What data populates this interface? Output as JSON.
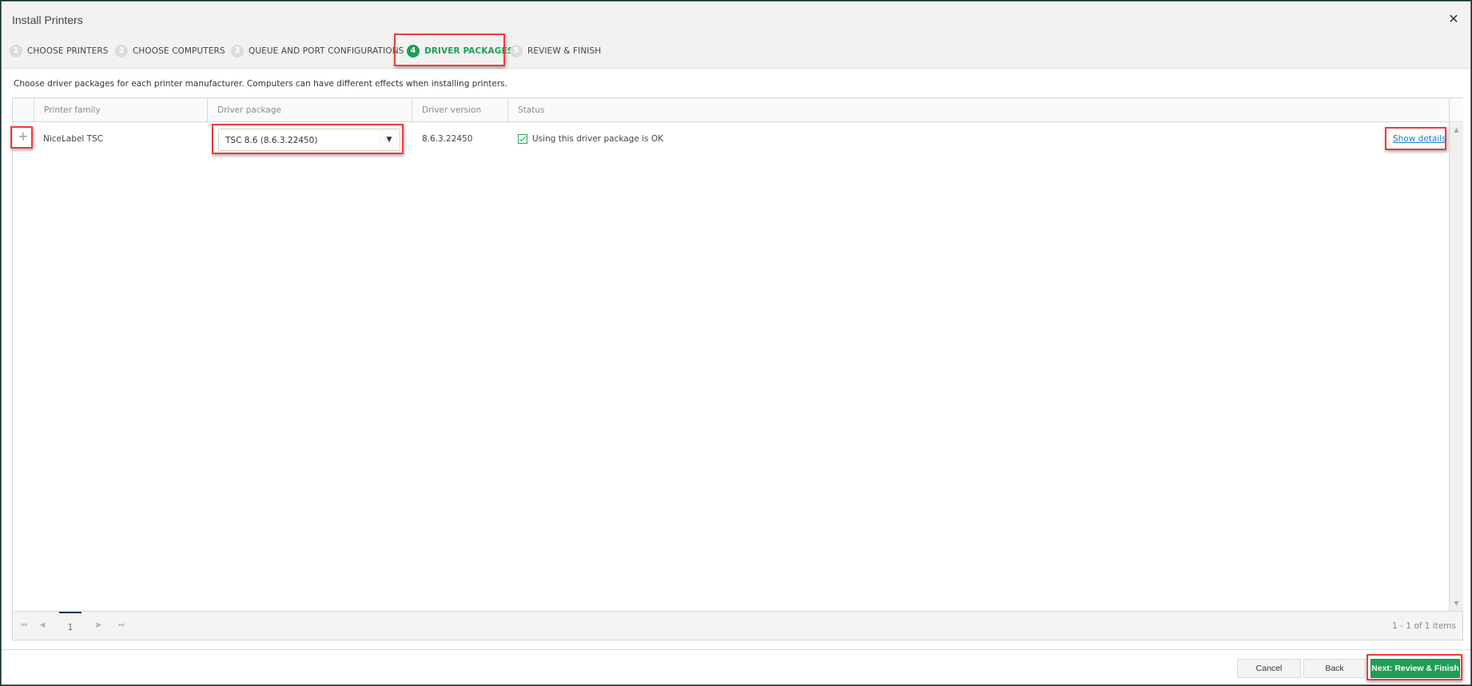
{
  "dialog": {
    "title": "Install Printers",
    "close_icon": "close-icon"
  },
  "wizard": {
    "steps": [
      {
        "number": "1",
        "label": "CHOOSE PRINTERS",
        "active": false
      },
      {
        "number": "2",
        "label": "CHOOSE COMPUTERS",
        "active": false
      },
      {
        "number": "3",
        "label": "QUEUE AND PORT CONFIGURATIONS",
        "active": false
      },
      {
        "number": "4",
        "label": "DRIVER PACKAGES",
        "active": true
      },
      {
        "number": "5",
        "label": "REVIEW & FINISH",
        "active": false
      }
    ]
  },
  "description": "Choose driver packages for each printer manufacturer. Computers can have different effects when installing printers.",
  "grid": {
    "columns": [
      "",
      "Printer family",
      "Driver package",
      "Driver version",
      "Status"
    ],
    "rows": [
      {
        "expand_symbol": "+",
        "printer_family": "NiceLabel TSC",
        "driver_package": "TSC 8.6 (8.6.3.22450)",
        "driver_version": "8.6.3.22450",
        "status_checked": true,
        "status": "Using this driver package is OK",
        "action_link": "Show details"
      }
    ],
    "pager": {
      "current_page": "1",
      "info": "1 - 1 of 1 items"
    }
  },
  "footer": {
    "cancel": "Cancel",
    "back": "Back",
    "next": "Next: Review & Finish"
  },
  "colors": {
    "accent_green": "#1e9e55",
    "link_blue": "#1a7bc4",
    "annotation_red": "#ee3b3b"
  }
}
